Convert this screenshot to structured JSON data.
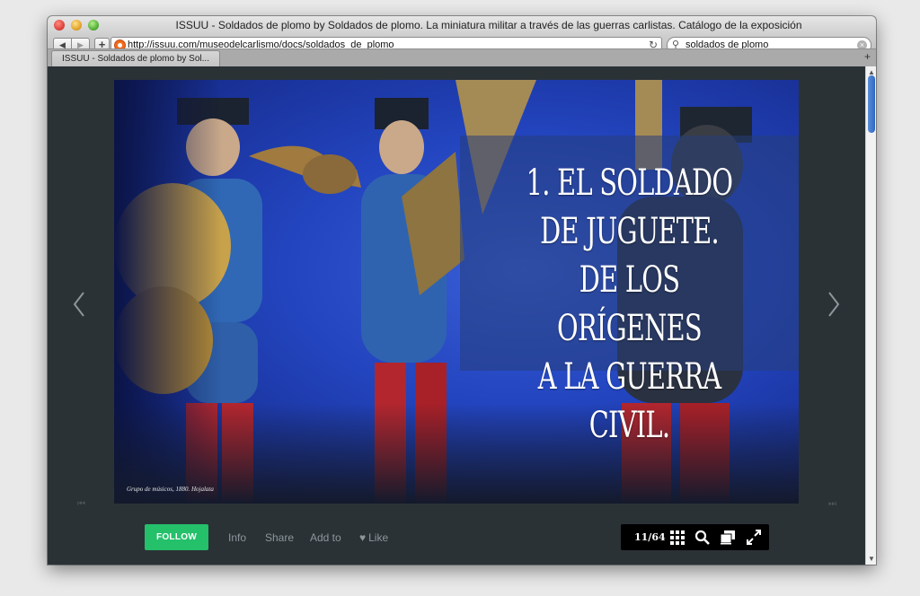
{
  "window": {
    "title": "ISSUU - Soldados de plomo by Soldados de plomo. La miniatura militar a través de las guerras carlistas. Catálogo de la exposición"
  },
  "toolbar": {
    "back_label": "◀",
    "forward_label": "▶",
    "add_label": "+",
    "url": "http://issuu.com/museodelcarlismo/docs/soldados_de_plomo",
    "search_value": "soldados de plomo"
  },
  "tabs": [
    {
      "label": "ISSUU - Soldados de plomo by Sol..."
    }
  ],
  "publication": {
    "heading_lines": [
      "1. EL SOLDADO",
      "DE JUGUETE.",
      "DE LOS ORÍGENES",
      "A LA GUERRA CIVIL."
    ],
    "caption": "Grupo de músicos, 1880. Hojalata"
  },
  "actions": {
    "follow": "FOLLOW",
    "info": "Info",
    "share": "Share",
    "add_to": "Add to",
    "like": "Like"
  },
  "viewer": {
    "page_indicator": "11/64"
  },
  "colors": {
    "follow_green": "#24c06a",
    "page_blue": "#1d3ea8",
    "viewer_bg": "#2a3236"
  },
  "icons": [
    "gear",
    "grid-icon",
    "search-icon",
    "pages-icon",
    "fullscreen-icon",
    "heart-icon",
    "chevron-left-icon",
    "chevron-right-icon"
  ]
}
